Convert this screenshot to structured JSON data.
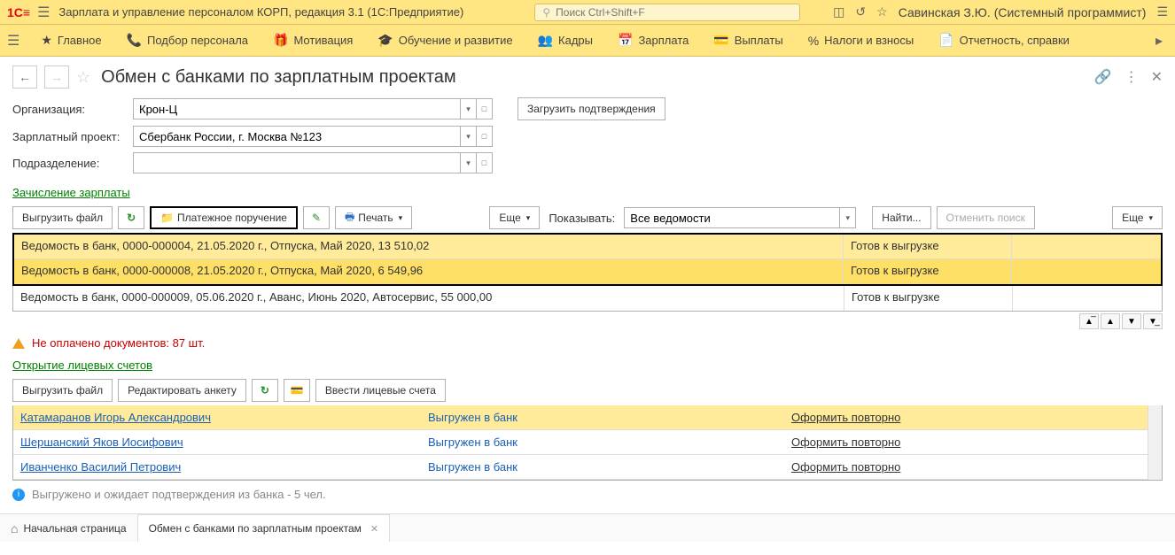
{
  "app": {
    "title": "Зарплата и управление персоналом КОРП, редакция 3.1  (1С:Предприятие)",
    "search_placeholder": "Поиск Ctrl+Shift+F",
    "user": "Савинская З.Ю. (Системный программист)"
  },
  "nav": {
    "items": [
      "Главное",
      "Подбор персонала",
      "Мотивация",
      "Обучение и развитие",
      "Кадры",
      "Зарплата",
      "Выплаты",
      "Налоги и взносы",
      "Отчетность, справки"
    ]
  },
  "page": {
    "title": "Обмен с банками по зарплатным проектам"
  },
  "form": {
    "org_label": "Организация:",
    "org_value": "Крон-Ц",
    "proj_label": "Зарплатный проект:",
    "proj_value": "Сбербанк России, г. Москва №123",
    "dept_label": "Подразделение:",
    "dept_value": "",
    "load_btn": "Загрузить подтверждения"
  },
  "section1": {
    "link": "Зачисление зарплаты",
    "btn_export": "Выгрузить файл",
    "btn_payment": "Платежное поручение",
    "btn_print": "Печать",
    "btn_more": "Еще",
    "lbl_show": "Показывать:",
    "show_value": "Все ведомости",
    "btn_find": "Найти...",
    "btn_cancel_find": "Отменить поиск",
    "rows": [
      {
        "desc": "Ведомость в банк, 0000-000004, 21.05.2020 г., Отпуска, Май 2020, 13 510,02",
        "status": "Готов к выгрузке"
      },
      {
        "desc": "Ведомость в банк, 0000-000008, 21.05.2020 г., Отпуска, Май 2020, 6 549,96",
        "status": "Готов к выгрузке"
      },
      {
        "desc": "Ведомость в банк, 0000-000009, 05.06.2020 г., Аванс, Июнь 2020, Автосервис, 55 000,00",
        "status": "Готов к выгрузке"
      }
    ]
  },
  "warning": "Не оплачено документов: 87 шт.",
  "section2": {
    "link": "Открытие лицевых счетов",
    "btn_export": "Выгрузить файл",
    "btn_edit": "Редактировать анкету",
    "btn_accounts": "Ввести лицевые счета",
    "rows": [
      {
        "name": "Катамаранов Игорь Александрович",
        "status": "Выгружен в банк",
        "action": "Оформить повторно"
      },
      {
        "name": "Шершанский Яков Иосифович",
        "status": "Выгружен в банк",
        "action": "Оформить повторно"
      },
      {
        "name": "Иванченко Василий Петрович",
        "status": "Выгружен в банк",
        "action": "Оформить повторно"
      }
    ]
  },
  "info": "Выгружено и ожидает подтверждения из банка - 5 чел.",
  "tabs": {
    "home": "Начальная страница",
    "current": "Обмен с банками по зарплатным проектам"
  }
}
